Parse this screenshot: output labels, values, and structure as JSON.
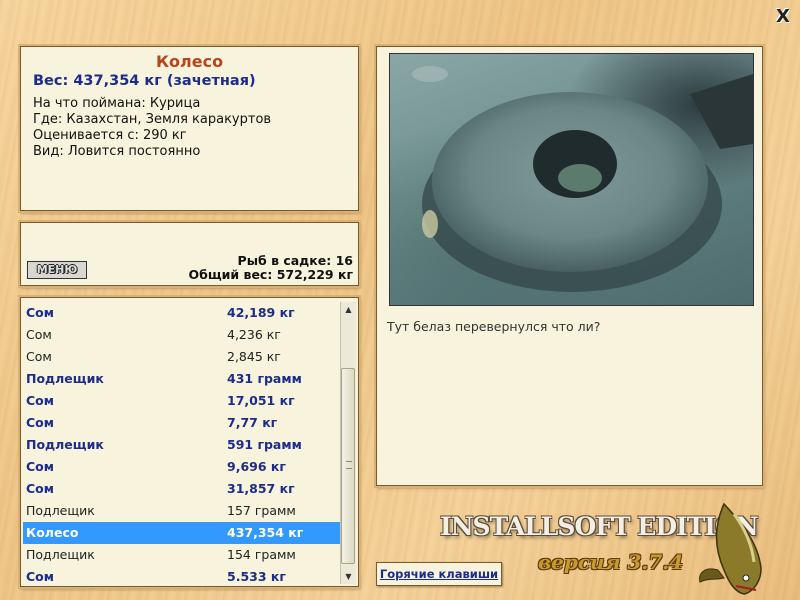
{
  "close_label": "X",
  "info": {
    "title": "Колесо",
    "weight": "Вес: 437,354 кг (зачетная)",
    "lines": [
      "На что поймана: Курица",
      "Где: Казахстан, Земля каракуртов",
      "Оценивается с: 290 кг",
      "Вид: Ловится постоянно"
    ]
  },
  "summary": {
    "menu_label": "МЕНЮ",
    "fish_count": "Рыб в садке: 16",
    "total_weight": "Общий вес: 572,229 кг"
  },
  "catch_list": [
    {
      "name": "Сом",
      "weight": "42,189 кг",
      "bold": true
    },
    {
      "name": "Сом",
      "weight": "4,236 кг",
      "bold": false
    },
    {
      "name": "Сом",
      "weight": "2,845 кг",
      "bold": false
    },
    {
      "name": "Подлещик",
      "weight": "431 грамм",
      "bold": true
    },
    {
      "name": "Сом",
      "weight": "17,051 кг",
      "bold": true
    },
    {
      "name": "Сом",
      "weight": "7,77 кг",
      "bold": true
    },
    {
      "name": "Подлещик",
      "weight": "591 грамм",
      "bold": true
    },
    {
      "name": "Сом",
      "weight": "9,696 кг",
      "bold": true
    },
    {
      "name": "Сом",
      "weight": "31,857 кг",
      "bold": true
    },
    {
      "name": "Подлещик",
      "weight": "157 грамм",
      "bold": false
    },
    {
      "name": "Колесо",
      "weight": "437,354 кг",
      "bold": true,
      "selected": true
    },
    {
      "name": "Подлещик",
      "weight": "154 грамм",
      "bold": false
    },
    {
      "name": "Сом",
      "weight": "5.533 кг",
      "bold": true
    }
  ],
  "photo_caption": "Тут белаз перевернулся что ли?",
  "hotkeys_label": "Горячие клавиши",
  "branding": {
    "name": "INSTALLSOFT EDITION",
    "version": "версия 3.7.4"
  },
  "colors": {
    "title": "#b8441a",
    "bold_text": "#1c2c8c",
    "selection": "#3399ff"
  }
}
